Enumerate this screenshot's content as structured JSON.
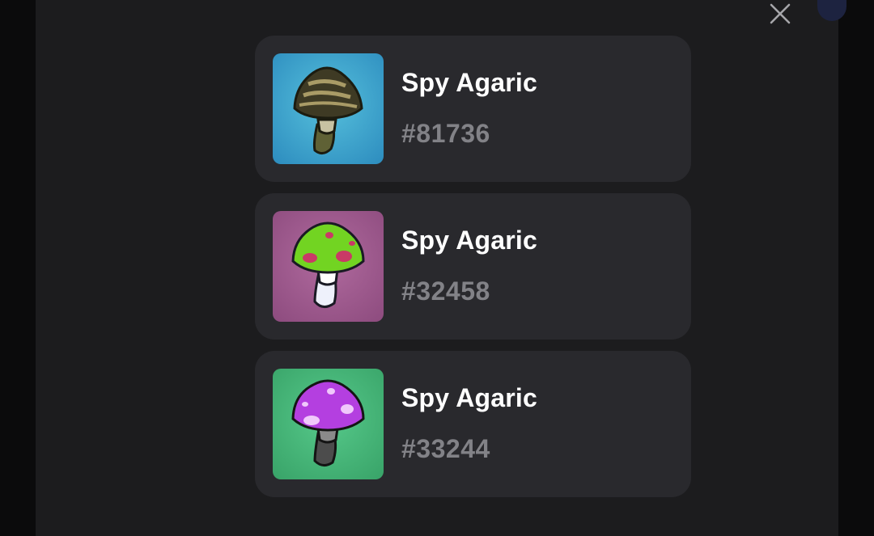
{
  "modal": {
    "close_icon": "close-icon"
  },
  "items": [
    {
      "name": "Spy Agaric",
      "number": "#81736",
      "icon": "mushroom-icon",
      "bg_color": "#3fa7c9",
      "cap_color": "#3f3a25",
      "stem_color": "#6b6a3d"
    },
    {
      "name": "Spy Agaric",
      "number": "#32458",
      "icon": "mushroom-icon",
      "bg_color": "#a15b8f",
      "cap_color": "#6fd421",
      "stem_color": "#e8ecf5"
    },
    {
      "name": "Spy Agaric",
      "number": "#33244",
      "icon": "mushroom-icon",
      "bg_color": "#46b97a",
      "cap_color": "#b53de0",
      "stem_color": "#4a4a4a"
    }
  ]
}
